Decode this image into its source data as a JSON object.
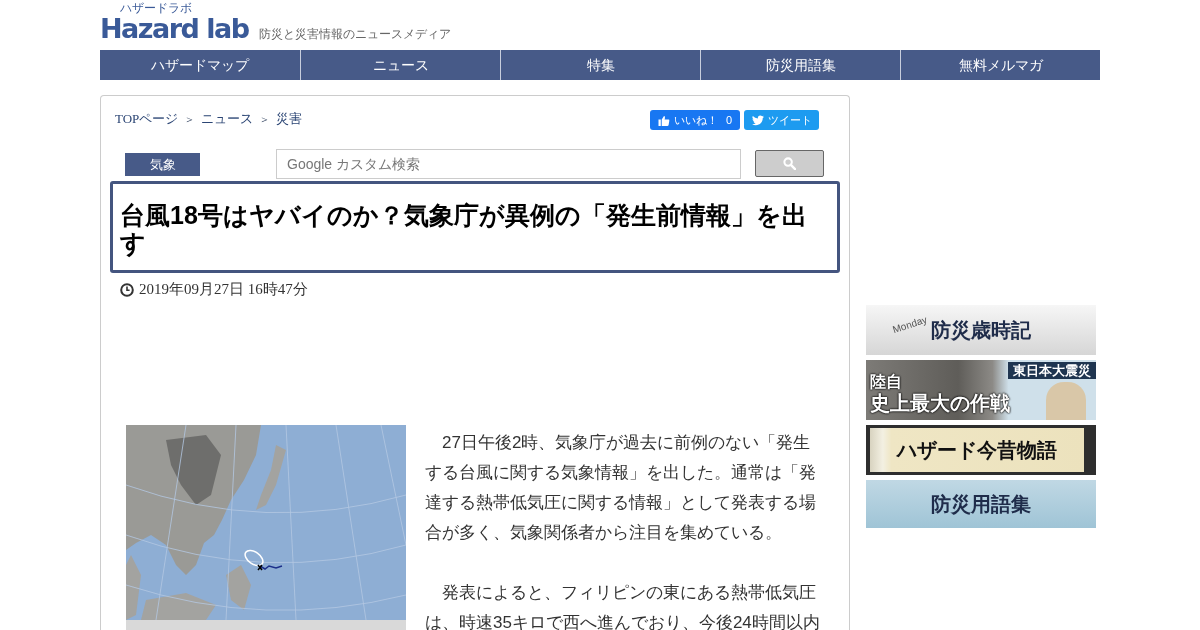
{
  "header": {
    "logo": {
      "text": "Hazard lab",
      "kana": "ハザードラボ"
    },
    "tagline": "防災と災害情報のニュースメディア"
  },
  "nav": [
    {
      "label": "ハザードマップ"
    },
    {
      "label": "ニュース"
    },
    {
      "label": "特集"
    },
    {
      "label": "防災用語集"
    },
    {
      "label": "無料メルマガ"
    }
  ],
  "breadcrumb": [
    {
      "kind": "link",
      "label": "TOPページ"
    },
    {
      "kind": "separator",
      "label": "＞"
    },
    {
      "kind": "link",
      "label": "ニュース"
    },
    {
      "kind": "separator",
      "label": "＞"
    },
    {
      "kind": "link",
      "label": "災害"
    }
  ],
  "social": [
    {
      "kind": "like",
      "label": "いいね！",
      "count": "0"
    },
    {
      "kind": "tweet",
      "label": "ツイート"
    }
  ],
  "category_tag": "気象",
  "search": {
    "placeholder": "Google カスタム検索"
  },
  "article": {
    "title": "台風18号はヤバイのか？気象庁が異例の「発生前情報」を出す",
    "date": "2019年09月27日 16時47分",
    "paragraphs": [
      "　27日午後2時、気象庁が過去に前例のない「発生する台風に関する気象情報」を出した。通常は「発達する熱帯低気圧に関する情報」として発表する場合が多く、気象関係者から注目を集めている。",
      "　発表によると、フィリピンの東にある熱帯低気圧は、時速35キロで西へ進んでおり、今後24時間以内"
    ]
  },
  "sidebar": {
    "banners": [
      {
        "kind": "calendar",
        "title": "防災歳時記",
        "decor": "Monday"
      },
      {
        "kind": "photo",
        "lines": [
          "陸自",
          "史上最大の作戦"
        ],
        "badge": "東日本大震災"
      },
      {
        "kind": "scroll",
        "title": "ハザード今昔物語"
      },
      {
        "kind": "sky",
        "title": "防災用語集"
      }
    ]
  }
}
